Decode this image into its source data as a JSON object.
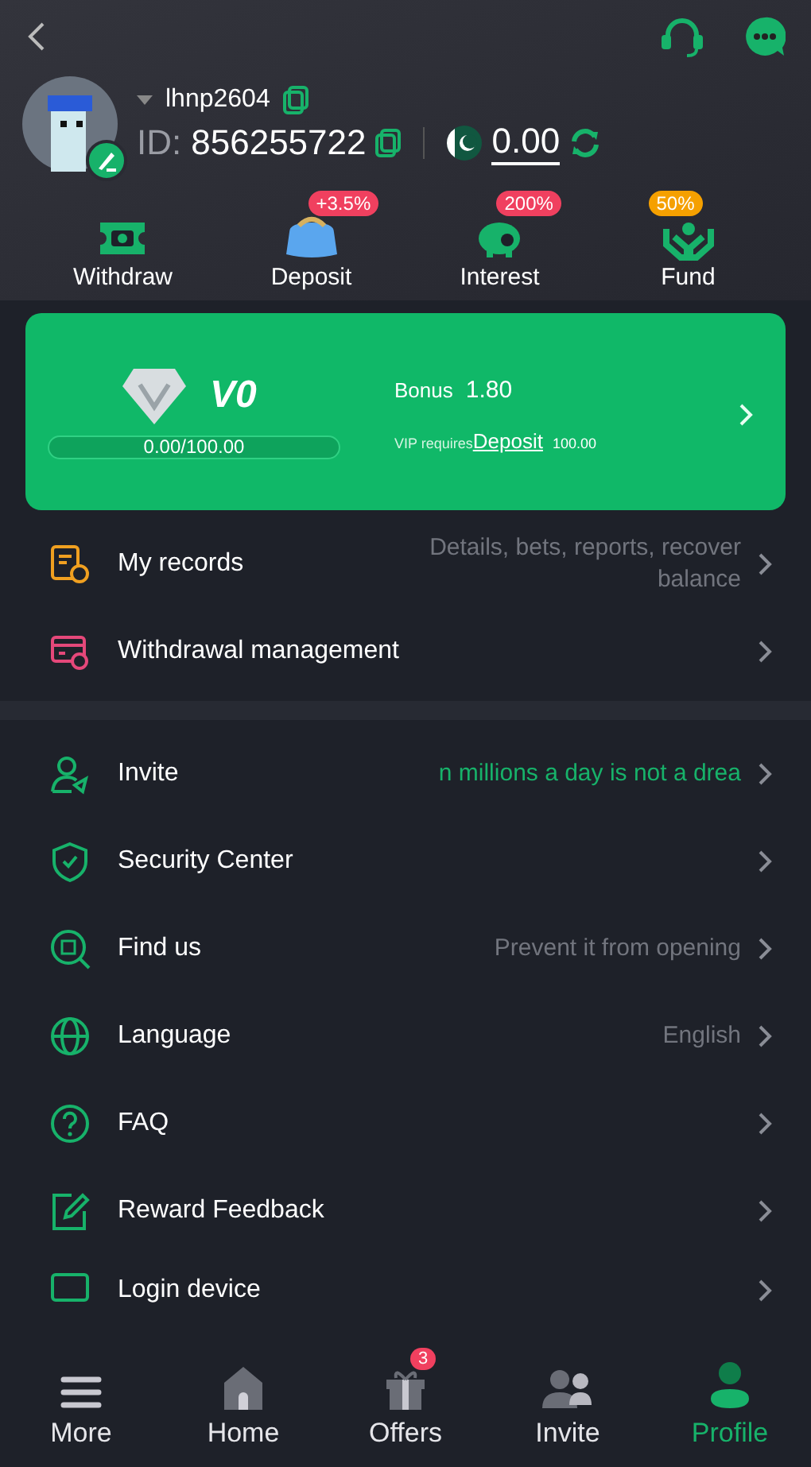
{
  "header": {
    "username": "lhnp2604",
    "id_label": "ID:",
    "id": "856255722",
    "balance": "0.00"
  },
  "actions": [
    {
      "kind": "withdraw",
      "label": "Withdraw"
    },
    {
      "kind": "deposit",
      "label": "Deposit",
      "badge": "+3.5%"
    },
    {
      "kind": "interest",
      "label": "Interest",
      "badge": "200%"
    },
    {
      "kind": "fund",
      "label": "Fund",
      "badge": "50%"
    }
  ],
  "vip": {
    "level_name": "V0",
    "progress": "0.00/100.00",
    "level": 0,
    "bonus_label": "Bonus",
    "bonus": "1.80",
    "requires": "VIP requires",
    "link": "Deposit",
    "amount": "100.00"
  },
  "menu_top": [
    {
      "kind": "records",
      "label": "My records",
      "detail": "Details, bets, reports, recover balance"
    },
    {
      "kind": "withdrawal",
      "label": "Withdrawal management"
    }
  ],
  "menu": [
    {
      "kind": "invite",
      "label": "Invite",
      "detail": "n millions a day is not a drea",
      "highlight": true
    },
    {
      "kind": "security",
      "label": "Security Center"
    },
    {
      "kind": "find",
      "label": "Find us",
      "detail": "Prevent it from opening",
      "highlight": false
    },
    {
      "kind": "language",
      "label": "Language",
      "detail": "English",
      "highlight": false
    },
    {
      "kind": "faq",
      "label": "FAQ"
    },
    {
      "kind": "feedback",
      "label": "Reward Feedback"
    },
    {
      "kind": "device",
      "label": "Login device"
    }
  ],
  "nav": [
    {
      "kind": "more",
      "label": "More",
      "selected": false
    },
    {
      "kind": "home",
      "label": "Home",
      "selected": false
    },
    {
      "kind": "offers",
      "label": "Offers",
      "selected": false,
      "badge": "3"
    },
    {
      "kind": "invite",
      "label": "Invite",
      "selected": false
    },
    {
      "kind": "profile",
      "label": "Profile",
      "selected": true
    }
  ]
}
